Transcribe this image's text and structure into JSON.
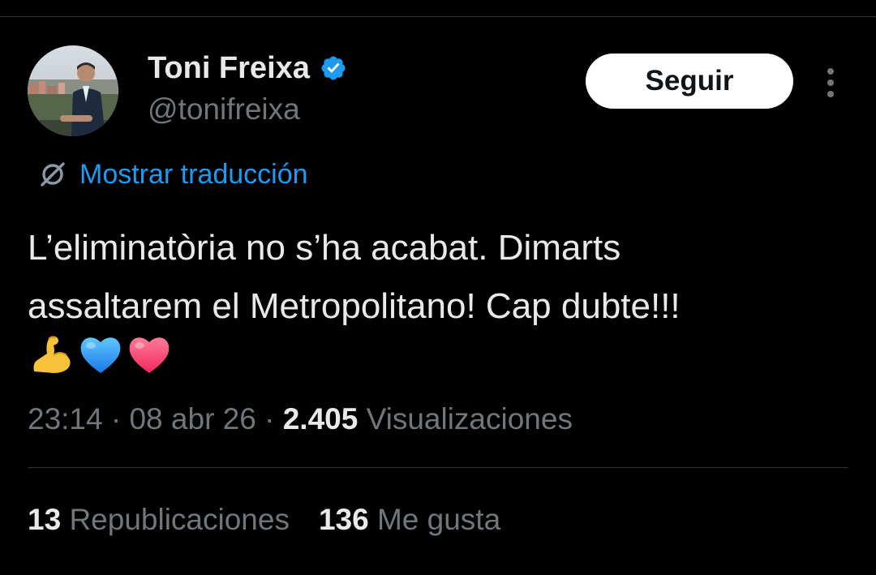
{
  "author": {
    "display_name": "Toni Freixa",
    "handle": "@tonifreixa",
    "verified_color": "#1d9bf0"
  },
  "actions": {
    "follow_label": "Seguir",
    "more_icon": "more-vertical-icon"
  },
  "translation": {
    "label": "Mostrar traducción",
    "icon": "translate-icon",
    "color": "#1d9bf0"
  },
  "tweet": {
    "line1": "L’eliminatòria no s’ha acabat. Dimarts",
    "line2": "assaltarem el Metropolitano! Cap dubte!!!",
    "emojis": [
      "flexed-biceps-icon",
      "blue-heart-icon",
      "pink-heart-icon"
    ]
  },
  "meta": {
    "time": "23:14",
    "separator": " · ",
    "date": "08 abr 26",
    "views_count": "2.405",
    "views_label": "Visualizaciones"
  },
  "stats": {
    "reposts_count": "13",
    "reposts_label": "Republicaciones",
    "likes_count": "136",
    "likes_label": "Me gusta"
  },
  "colors": {
    "background": "#000000",
    "text_primary": "#e7e9ea",
    "text_secondary": "#71767b",
    "divider": "#2f3336",
    "accent": "#1d9bf0"
  }
}
